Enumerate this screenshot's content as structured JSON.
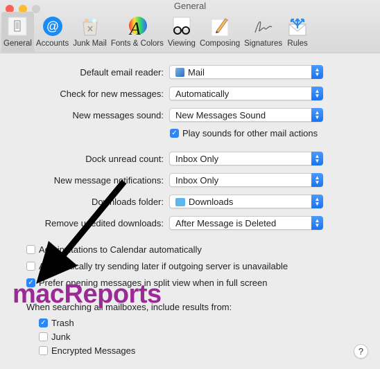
{
  "window": {
    "title": "General"
  },
  "toolbar": {
    "items": [
      {
        "label": "General",
        "icon": "general-switch-icon",
        "active": true
      },
      {
        "label": "Accounts",
        "icon": "at-sign-icon"
      },
      {
        "label": "Junk Mail",
        "icon": "trash-bin-icon"
      },
      {
        "label": "Fonts & Colors",
        "icon": "color-wheel-font-icon"
      },
      {
        "label": "Viewing",
        "icon": "glasses-icon"
      },
      {
        "label": "Composing",
        "icon": "pencil-paper-icon"
      },
      {
        "label": "Signatures",
        "icon": "signature-icon"
      },
      {
        "label": "Rules",
        "icon": "envelope-arrows-icon"
      }
    ]
  },
  "settings": {
    "default_reader": {
      "label": "Default email reader:",
      "value": "Mail"
    },
    "check_messages": {
      "label": "Check for new messages:",
      "value": "Automatically"
    },
    "sound": {
      "label": "New messages sound:",
      "value": "New Messages Sound"
    },
    "play_sounds": {
      "label": "Play sounds for other mail actions",
      "checked": true
    },
    "dock_count": {
      "label": "Dock unread count:",
      "value": "Inbox Only"
    },
    "notifications": {
      "label": "New message notifications:",
      "value": "Inbox Only"
    },
    "downloads_folder": {
      "label": "Downloads folder:",
      "value": "Downloads"
    },
    "remove_downloads": {
      "label": "Remove unedited downloads:",
      "value": "After Message is Deleted"
    },
    "add_invitations": {
      "label": "Add invitations to Calendar automatically",
      "checked": false
    },
    "try_later": {
      "label": "Automatically try sending later if outgoing server is unavailable",
      "checked": false
    },
    "split_view": {
      "label": "Prefer opening messages in split view when in full screen",
      "checked": true
    },
    "search_heading": "When searching all mailboxes, include results from:",
    "search_trash": {
      "label": "Trash",
      "checked": true
    },
    "search_junk": {
      "label": "Junk",
      "checked": false
    },
    "search_encrypted": {
      "label": "Encrypted Messages",
      "checked": false
    }
  },
  "help": {
    "label": "?"
  },
  "overlay": {
    "watermark": "macReports"
  },
  "colors": {
    "accent": "#2c86f5",
    "watermark": "#9b2a96"
  }
}
